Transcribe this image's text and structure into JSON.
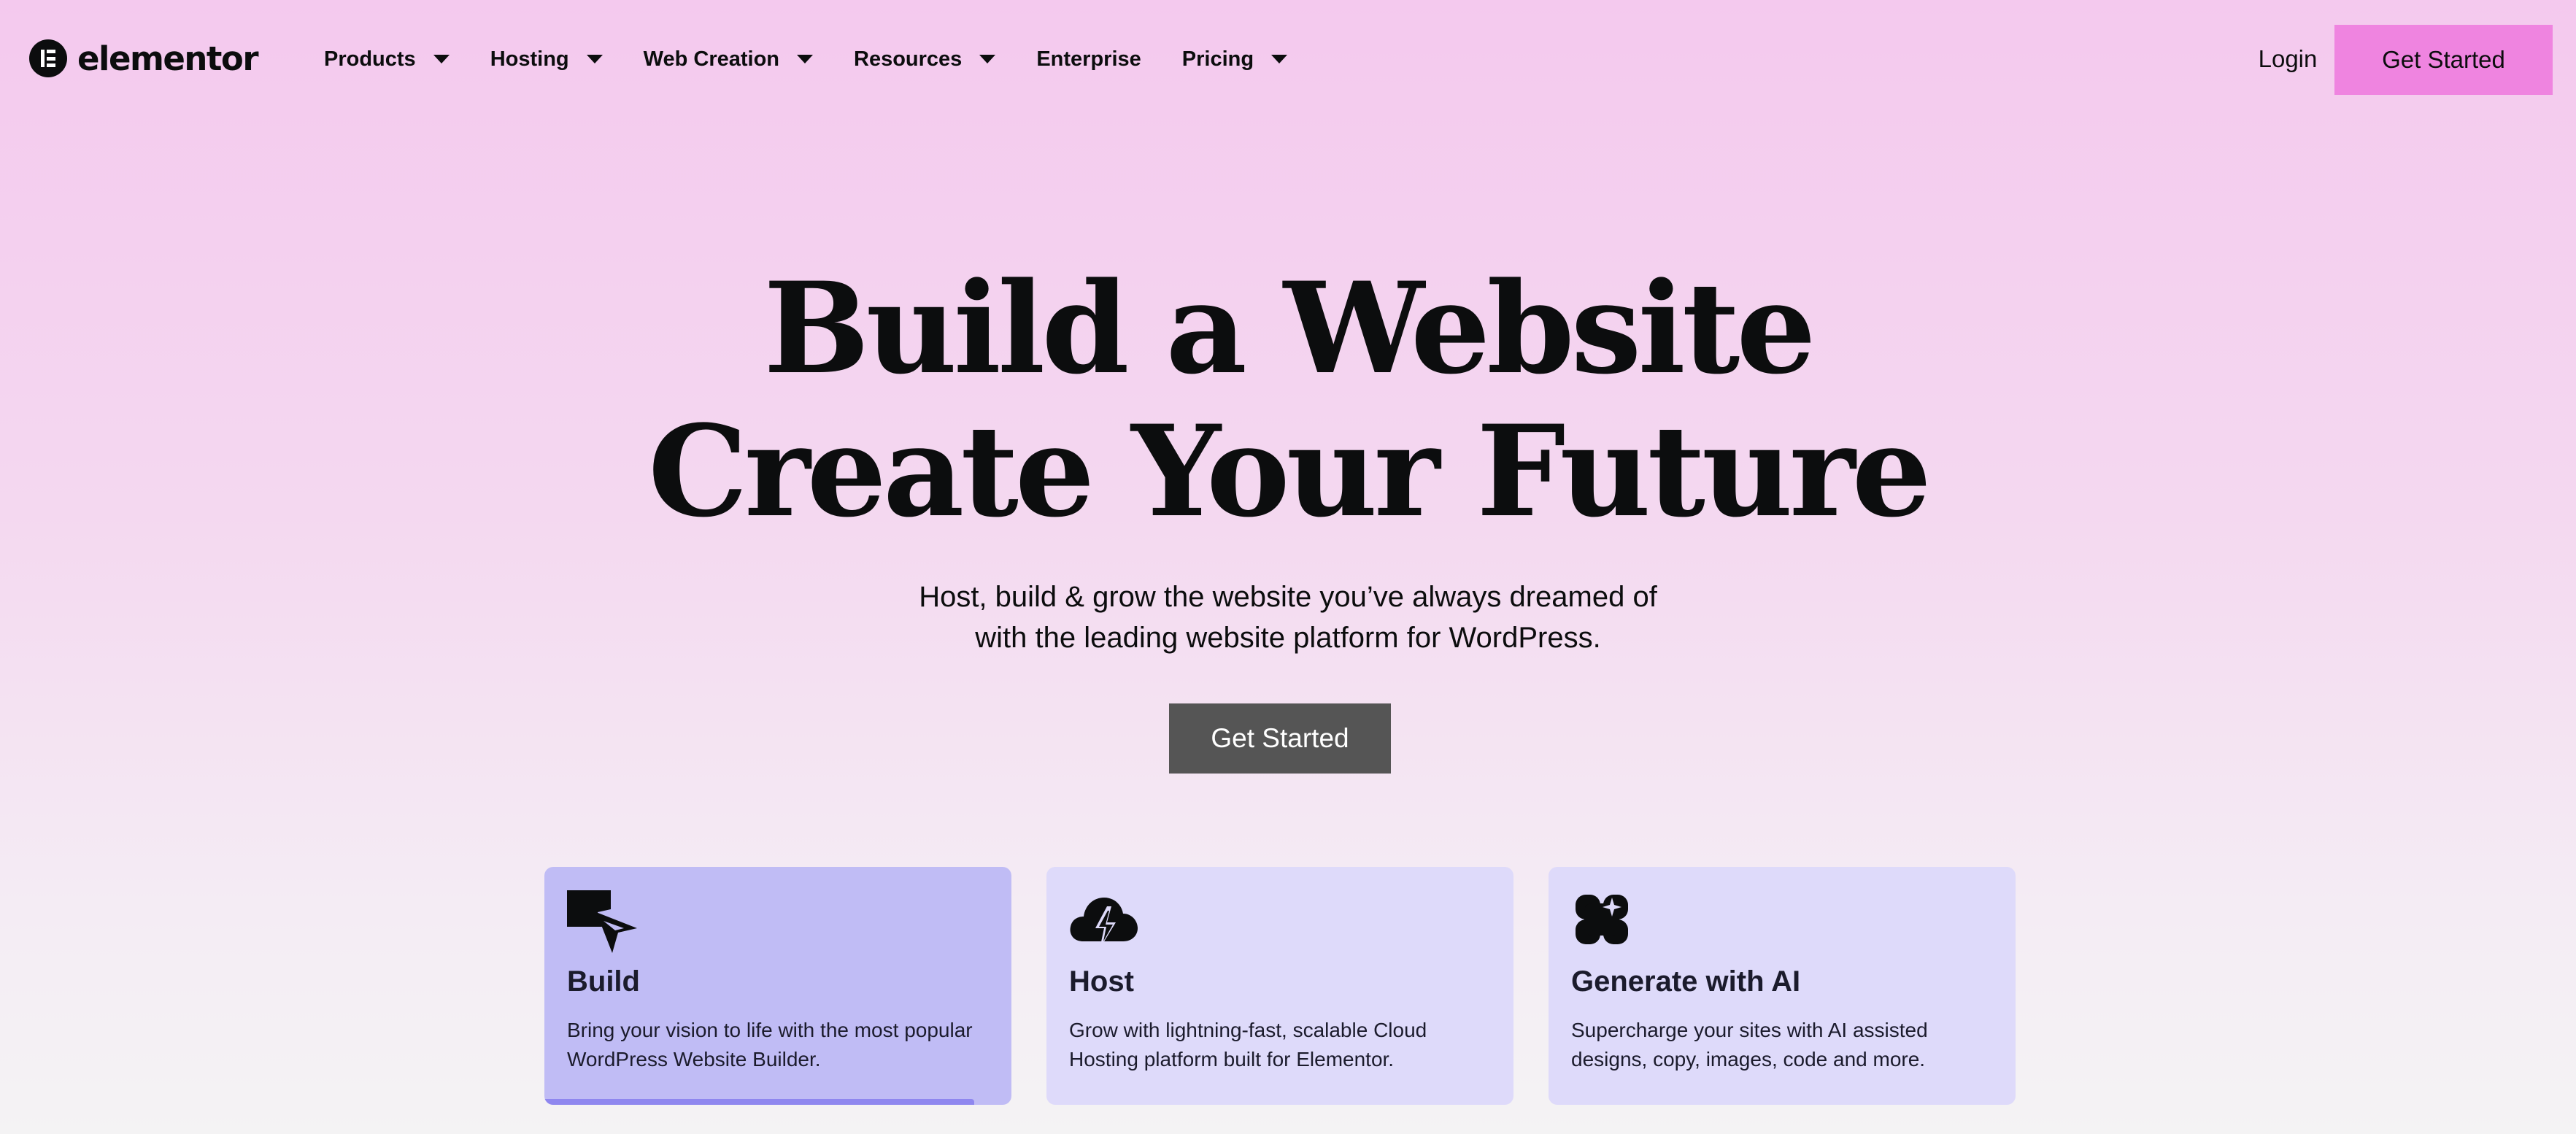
{
  "brand": {
    "name": "elementor"
  },
  "nav": {
    "items": [
      {
        "label": "Products",
        "has_dropdown": true
      },
      {
        "label": "Hosting",
        "has_dropdown": true
      },
      {
        "label": "Web Creation",
        "has_dropdown": true
      },
      {
        "label": "Resources",
        "has_dropdown": true
      },
      {
        "label": "Enterprise",
        "has_dropdown": false
      },
      {
        "label": "Pricing",
        "has_dropdown": true
      }
    ],
    "login_label": "Login",
    "cta_label": "Get Started"
  },
  "hero": {
    "title_lines": [
      "Build a Website",
      "Create Your Future"
    ],
    "subtitle_lines": [
      "Host, build & grow the website you’ve always dreamed of",
      "with the leading website platform for WordPress."
    ],
    "cta_label": "Get Started"
  },
  "features": [
    {
      "title": "Build",
      "icon": "build-cursor-icon",
      "desc_lines": [
        "Bring your vision to life with the most popular",
        "WordPress Website Builder."
      ],
      "active": true,
      "progress": 0.92
    },
    {
      "title": "Host",
      "icon": "cloud-lightning-icon",
      "desc_lines": [
        "Grow with lightning-fast, scalable Cloud",
        "Hosting platform built for Elementor."
      ],
      "active": false
    },
    {
      "title": "Generate with AI",
      "icon": "ai-sparkle-icon",
      "desc_lines": [
        "Supercharge your sites with AI assisted",
        "designs, copy, images, code and more."
      ],
      "active": false
    }
  ],
  "colors": {
    "page_gradient_top": "#f4c9ee",
    "page_gradient_bottom": "#f4f3f4",
    "header_cta_bg": "#ef84e0",
    "hero_cta_bg": "#555555",
    "card_bg": "#dedafa",
    "card_active_bg": "#c0bcf5",
    "card_progress": "#8f87ef"
  }
}
